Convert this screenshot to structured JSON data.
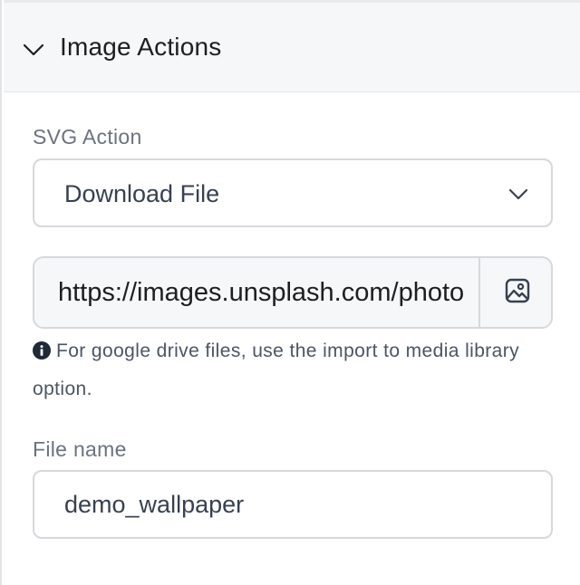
{
  "section": {
    "title": "Image Actions",
    "expanded": true
  },
  "svg_action": {
    "label": "SVG Action",
    "selected": "Download File"
  },
  "url": {
    "value": "https://images.unsplash.com/photo",
    "button_icon": "image-icon"
  },
  "help": {
    "icon": "info-icon",
    "text": "For google drive files, use the import to media library option."
  },
  "file_name": {
    "label": "File name",
    "value": "demo_wallpaper"
  },
  "colors": {
    "border": "#d5d8dc",
    "header_bg": "#f6f7f8",
    "text": "#1e1e1e",
    "muted": "#6b7280"
  }
}
